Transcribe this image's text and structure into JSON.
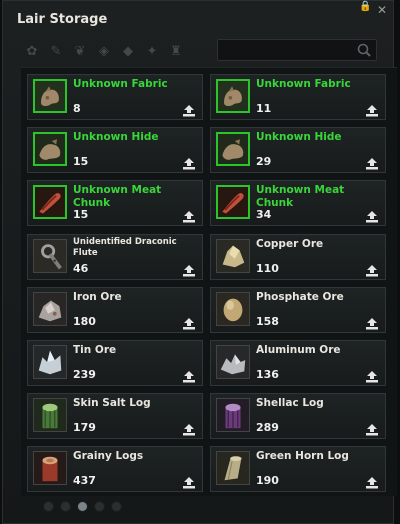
{
  "window": {
    "title": "Lair Storage"
  },
  "filters": [
    {
      "icon": "materials-icon"
    },
    {
      "icon": "tools-icon"
    },
    {
      "icon": "leaf-icon"
    },
    {
      "icon": "hide-icon"
    },
    {
      "icon": "gem-icon"
    },
    {
      "icon": "ore-icon"
    },
    {
      "icon": "bag-icon"
    }
  ],
  "search": {
    "placeholder": "",
    "icon": "search-icon"
  },
  "items": [
    {
      "name": "Unknown Fabric",
      "qty": "8",
      "rarity": "green",
      "icon": "fabric-icon"
    },
    {
      "name": "Unknown Fabric",
      "qty": "11",
      "rarity": "green",
      "icon": "fabric-icon"
    },
    {
      "name": "Unknown Hide",
      "qty": "15",
      "rarity": "green",
      "icon": "hide-icon"
    },
    {
      "name": "Unknown Hide",
      "qty": "29",
      "rarity": "green",
      "icon": "hide-icon"
    },
    {
      "name": "Unknown Meat Chunk",
      "qty": "15",
      "rarity": "green",
      "icon": "meat-icon"
    },
    {
      "name": "Unknown Meat Chunk",
      "qty": "34",
      "rarity": "green",
      "icon": "meat-icon"
    },
    {
      "name": "Unidentified Draconic Flute",
      "qty": "46",
      "rarity": "white",
      "icon": "flute-icon"
    },
    {
      "name": "Copper Ore",
      "qty": "110",
      "rarity": "white",
      "icon": "copper-ore-icon"
    },
    {
      "name": "Iron Ore",
      "qty": "180",
      "rarity": "white",
      "icon": "iron-ore-icon"
    },
    {
      "name": "Phosphate Ore",
      "qty": "158",
      "rarity": "white",
      "icon": "phosphate-ore-icon"
    },
    {
      "name": "Tin Ore",
      "qty": "239",
      "rarity": "white",
      "icon": "tin-ore-icon"
    },
    {
      "name": "Aluminum Ore",
      "qty": "136",
      "rarity": "white",
      "icon": "aluminum-ore-icon"
    },
    {
      "name": "Skin Salt Log",
      "qty": "179",
      "rarity": "white",
      "icon": "green-log-icon"
    },
    {
      "name": "Shellac Log",
      "qty": "289",
      "rarity": "white",
      "icon": "purple-log-icon"
    },
    {
      "name": "Grainy Logs",
      "qty": "437",
      "rarity": "white",
      "icon": "red-log-icon"
    },
    {
      "name": "Green Horn Log",
      "qty": "190",
      "rarity": "white",
      "icon": "horn-log-icon"
    }
  ],
  "pager": {
    "count": 5,
    "active": 3
  },
  "colors": {
    "green": "#39d639",
    "white": "#e8e6de"
  }
}
